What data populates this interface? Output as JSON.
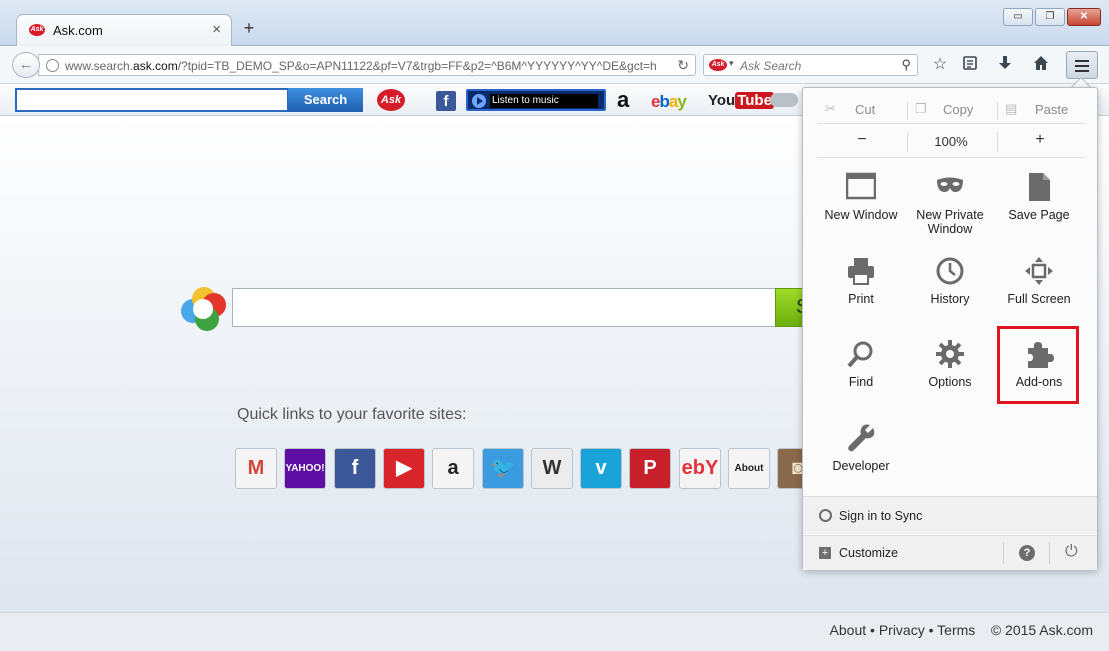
{
  "tab": {
    "title": "Ask.com",
    "close": "×",
    "favicon": "Ask"
  },
  "new_tab": "+",
  "window": {
    "minimize": "▭",
    "restore": "❐",
    "close": "✕"
  },
  "nav": {
    "url_prefix": "www.search.",
    "url_host": "ask.com",
    "url_rest": "/?tpid=TB_DEMO_SP&o=APN11122&pf=V7&trgb=FF&p2=^B6M^YYYYYY^YY^DE&gct=h",
    "search_placeholder": "Ask Search",
    "search_logo": "Ask"
  },
  "ask_toolbar": {
    "search_label": "Search",
    "logo": "Ask",
    "music_label": "Listen to music",
    "facebook": "f",
    "amazon": "a",
    "youtube_you": "You",
    "youtube_tube": "Tube",
    "ebay": [
      "e",
      "b",
      "a",
      "y"
    ]
  },
  "main": {
    "search_button_glyph": "S",
    "quicklinks_label": "Quick links to your favorite sites:",
    "quicklinks": [
      {
        "name": "Gmail",
        "text": "M",
        "bg": "#f4f4f4",
        "color": "#d4453a"
      },
      {
        "name": "Yahoo",
        "text": "YAHOO!",
        "bg": "#5f0ea3",
        "color": "#ffffff"
      },
      {
        "name": "Facebook",
        "text": "f",
        "bg": "#3b5998",
        "color": "#ffffff"
      },
      {
        "name": "YouTube",
        "text": "▶",
        "bg": "#d8252b",
        "color": "#ffffff"
      },
      {
        "name": "Amazon",
        "text": "a",
        "bg": "#f4f4f4",
        "color": "#222222"
      },
      {
        "name": "Twitter",
        "text": "🐦",
        "bg": "#3a9be0",
        "color": "#ffffff"
      },
      {
        "name": "Wikipedia",
        "text": "W",
        "bg": "#ececec",
        "color": "#333333"
      },
      {
        "name": "Vimeo",
        "text": "v",
        "bg": "#1aa3d8",
        "color": "#ffffff"
      },
      {
        "name": "Pinterest",
        "text": "P",
        "bg": "#c8202a",
        "color": "#ffffff"
      },
      {
        "name": "eBay",
        "text": "ebY",
        "bg": "#f4f4f4",
        "color": "#e53238"
      },
      {
        "name": "About",
        "text": "About",
        "bg": "#f4f4f4",
        "color": "#222222"
      },
      {
        "name": "Instagram",
        "text": "◙",
        "bg": "#8a6a4c",
        "color": "#f4e6cf"
      }
    ]
  },
  "footer": {
    "about": "About",
    "privacy": "Privacy",
    "terms": "Terms",
    "copyright": "© 2015 Ask.com",
    "dot": "•"
  },
  "menu": {
    "cut": "Cut",
    "copy": "Copy",
    "paste": "Paste",
    "zoom_out": "−",
    "zoom_level": "100%",
    "zoom_in": "+",
    "items": [
      {
        "label": "New Window",
        "icon": "window-icon"
      },
      {
        "label": "New Private Window",
        "icon": "mask-icon"
      },
      {
        "label": "Save Page",
        "icon": "page-icon"
      },
      {
        "label": "Print",
        "icon": "printer-icon"
      },
      {
        "label": "History",
        "icon": "clock-icon"
      },
      {
        "label": "Full Screen",
        "icon": "fullscreen-icon"
      },
      {
        "label": "Find",
        "icon": "magnifier-icon"
      },
      {
        "label": "Options",
        "icon": "gear-icon"
      },
      {
        "label": "Add-ons",
        "icon": "puzzle-icon"
      },
      {
        "label": "Developer",
        "icon": "wrench-icon"
      }
    ],
    "sync": "Sign in to Sync",
    "customize": "Customize",
    "help": "?",
    "highlight_color": "#e0141e"
  }
}
